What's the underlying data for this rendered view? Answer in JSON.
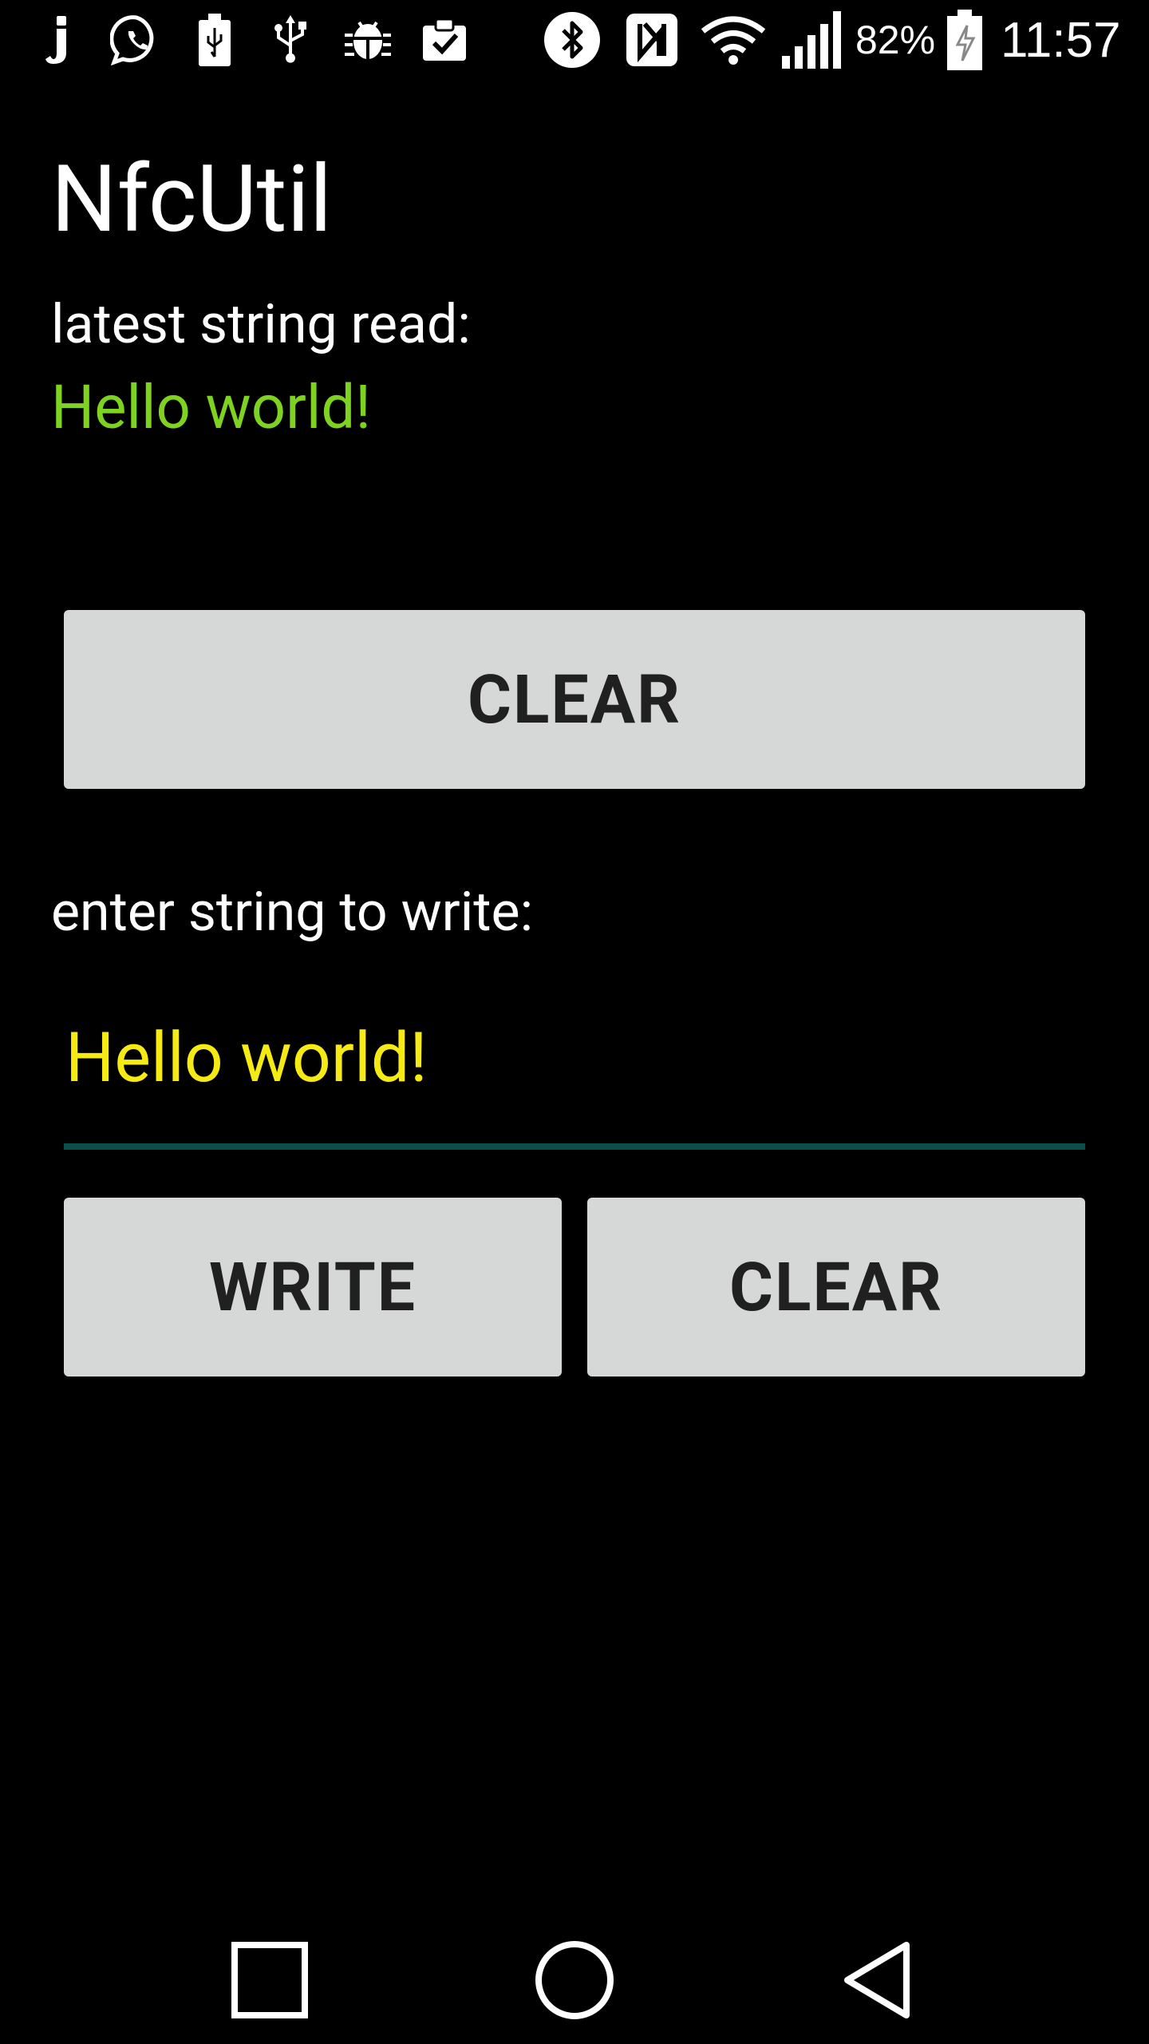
{
  "status_bar": {
    "icons": [
      "juice-app-icon",
      "whatsapp-icon",
      "usb-storage-icon",
      "usb-icon",
      "android-debug-icon",
      "clipboard-check-icon",
      "bluetooth-icon",
      "nfc-icon",
      "wifi-icon",
      "cell-signal-icon",
      "battery-charging-icon"
    ],
    "battery_percent": "82%",
    "time": "11:57"
  },
  "app": {
    "title": "NfcUtil"
  },
  "read_section": {
    "label": "latest string read:",
    "value": "Hello world!",
    "value_color": "#7ed321",
    "clear_label": "CLEAR"
  },
  "write_section": {
    "label": "enter string to write:",
    "input_value": "Hello world!",
    "input_color": "#f5ea14",
    "underline_color": "#0b4f4a",
    "write_label": "WRITE",
    "clear_label": "CLEAR"
  },
  "nav_bar": {
    "buttons": [
      "recent-apps-icon",
      "home-icon",
      "back-icon"
    ]
  },
  "colors": {
    "background": "#000000",
    "button_bg": "#d6d7d7",
    "button_text": "#202020"
  }
}
